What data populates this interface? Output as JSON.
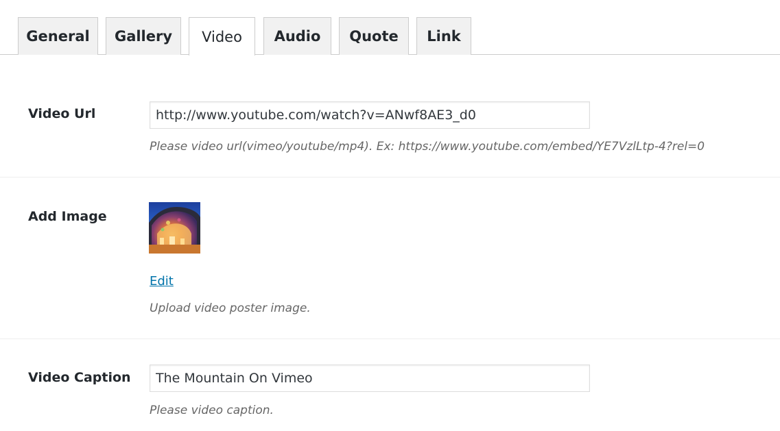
{
  "tabs": [
    {
      "label": "General",
      "active": false
    },
    {
      "label": "Gallery",
      "active": false
    },
    {
      "label": "Video",
      "active": true
    },
    {
      "label": "Audio",
      "active": false
    },
    {
      "label": "Quote",
      "active": false
    },
    {
      "label": "Link",
      "active": false
    }
  ],
  "fields": {
    "video_url": {
      "label": "Video Url",
      "value": "http://www.youtube.com/watch?v=ANwf8AE3_d0",
      "description": "Please video url(vimeo/youtube/mp4). Ex: https://www.youtube.com/embed/YE7VzlLtp-4?rel=0"
    },
    "add_image": {
      "label": "Add Image",
      "edit_label": "Edit",
      "description": "Upload video poster image."
    },
    "video_caption": {
      "label": "Video Caption",
      "value": "The Mountain On Vimeo",
      "description": "Please video caption."
    }
  },
  "colors": {
    "link": "#0073aa",
    "tab_inactive_bg": "#f1f1f1",
    "border": "#cccccc",
    "description_text": "#666666"
  }
}
